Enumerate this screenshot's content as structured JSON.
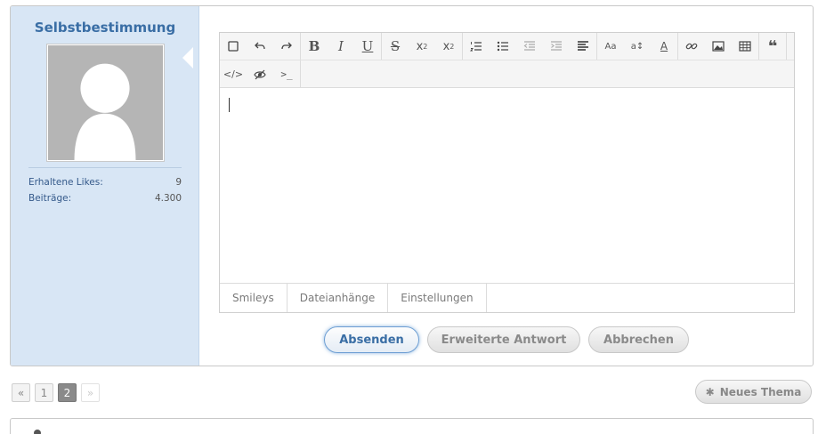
{
  "user": {
    "name": "Selbstbestimmung",
    "stats": [
      {
        "label": "Erhaltene Likes:",
        "value": "9"
      },
      {
        "label": "Beiträge:",
        "value": "4.300"
      }
    ]
  },
  "editor": {
    "toolbar_row1": [
      {
        "group": "history",
        "items": [
          "source-mode-icon",
          "undo-icon",
          "redo-icon"
        ]
      },
      {
        "group": "text",
        "items": [
          "bold-icon",
          "italic-icon",
          "underline-icon"
        ]
      },
      {
        "group": "script",
        "items": [
          "strikethrough-icon",
          "subscript-icon",
          "superscript-icon"
        ]
      },
      {
        "group": "lists",
        "items": [
          "ordered-list-icon",
          "unordered-list-icon",
          "outdent-icon",
          "indent-icon",
          "align-icon"
        ]
      },
      {
        "group": "font",
        "items": [
          "font-family-icon",
          "font-size-icon",
          "font-color-icon"
        ]
      },
      {
        "group": "insert",
        "items": [
          "link-icon",
          "image-icon",
          "table-icon"
        ]
      },
      {
        "group": "quote",
        "items": [
          "quote-icon"
        ]
      }
    ],
    "toolbar_row2": [
      "code-icon",
      "spoiler-icon",
      "terminal-icon"
    ],
    "tabs": [
      "Smileys",
      "Dateianhänge",
      "Einstellungen"
    ]
  },
  "actions": {
    "submit": "Absenden",
    "advanced": "Erweiterte Antwort",
    "cancel": "Abbrechen"
  },
  "pagination": {
    "prev": "«",
    "pages": [
      "1",
      "2"
    ],
    "current": "2",
    "next": "»"
  },
  "new_topic_label": "Neues Thema"
}
